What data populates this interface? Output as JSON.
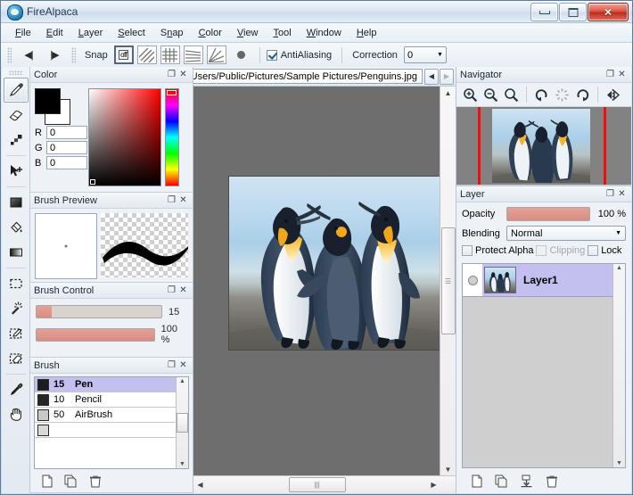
{
  "window": {
    "title": "FireAlpaca",
    "app_icon": "alpaca-icon",
    "minimize_label": "Minimize",
    "maximize_label": "Restore",
    "close_label": "Close"
  },
  "menubar": {
    "items": [
      {
        "label": "File",
        "accel": "F"
      },
      {
        "label": "Edit",
        "accel": "E"
      },
      {
        "label": "Layer",
        "accel": "L"
      },
      {
        "label": "Select",
        "accel": "S"
      },
      {
        "label": "Snap",
        "accel": "n"
      },
      {
        "label": "Color",
        "accel": "C"
      },
      {
        "label": "View",
        "accel": "V"
      },
      {
        "label": "Tool",
        "accel": "T"
      },
      {
        "label": "Window",
        "accel": "W"
      },
      {
        "label": "Help",
        "accel": "H"
      }
    ]
  },
  "toolbar": {
    "prev_label": "◀|",
    "next_label": "|▶",
    "snap_label": "Snap",
    "snap_options": [
      {
        "name": "snap-off",
        "label": "off",
        "selected": true
      },
      {
        "name": "snap-parallel",
        "label": "",
        "selected": false
      },
      {
        "name": "snap-grid",
        "label": "",
        "selected": false
      },
      {
        "name": "snap-perspective",
        "label": "",
        "selected": false
      },
      {
        "name": "snap-radial",
        "label": "",
        "selected": false
      },
      {
        "name": "snap-point",
        "label": "",
        "selected": false
      }
    ],
    "antialiasing_label": "AntiAliasing",
    "antialiasing_checked": true,
    "correction_label": "Correction",
    "correction_value": "0"
  },
  "tools": {
    "items": [
      {
        "name": "pencil-tool",
        "label": "Pencil",
        "selected": true
      },
      {
        "name": "eraser-tool",
        "label": "Eraser",
        "selected": false
      },
      {
        "name": "blur-tool",
        "label": "Blur",
        "selected": false
      },
      {
        "name": "move-tool",
        "label": "Move",
        "selected": false
      },
      {
        "name": "fill-tool",
        "label": "Fill",
        "selected": false
      },
      {
        "name": "bucket-tool",
        "label": "Bucket",
        "selected": false
      },
      {
        "name": "gradient-tool",
        "label": "Gradient",
        "selected": false
      },
      {
        "name": "select-tool",
        "label": "Select",
        "selected": false
      },
      {
        "name": "magic-wand-tool",
        "label": "Magic Wand",
        "selected": false
      },
      {
        "name": "select-pen-tool",
        "label": "Select Pen",
        "selected": false
      },
      {
        "name": "select-eraser-tool",
        "label": "Select Eraser",
        "selected": false
      },
      {
        "name": "eyedropper-tool",
        "label": "Eyedropper",
        "selected": false
      },
      {
        "name": "hand-tool",
        "label": "Hand",
        "selected": false
      }
    ]
  },
  "color_panel": {
    "title": "Color",
    "foreground": "#000000",
    "background": "#ffffff",
    "r_label": "R",
    "g_label": "G",
    "b_label": "B",
    "r_value": "0",
    "g_value": "0",
    "b_value": "0"
  },
  "brush_preview": {
    "title": "Brush Preview"
  },
  "brush_control": {
    "title": "Brush Control",
    "size_value": "15",
    "size_percent": 12,
    "opacity_value": "100 %",
    "opacity_percent": 100
  },
  "brush_panel": {
    "title": "Brush",
    "items": [
      {
        "size": "15",
        "label": "Pen",
        "swatch": "#1c1c1c",
        "selected": true
      },
      {
        "size": "10",
        "label": "Pencil",
        "swatch": "#262626",
        "selected": false
      },
      {
        "size": "50",
        "label": "AirBrush",
        "swatch": "#c9c9c9",
        "selected": false
      }
    ],
    "footer": [
      {
        "name": "new-brush-button",
        "label": "New"
      },
      {
        "name": "duplicate-brush-button",
        "label": "Duplicate"
      },
      {
        "name": "delete-brush-button",
        "label": "Delete"
      }
    ]
  },
  "document": {
    "tab_title": "s.jpg - C:/Users/Public/Pictures/Sample Pictures/Penguins.jpg",
    "prev_tab": "◀",
    "next_tab": "▶",
    "canvas_background": "#6e6e6e"
  },
  "navigator": {
    "title": "Navigator",
    "buttons": [
      {
        "name": "zoom-in-icon",
        "label": "Zoom In"
      },
      {
        "name": "zoom-out-icon",
        "label": "Zoom Out"
      },
      {
        "name": "zoom-reset-icon",
        "label": "Zoom Reset"
      },
      {
        "name": "rotate-left-icon",
        "label": "Rotate Left"
      },
      {
        "name": "rotate-reset-icon",
        "label": "Rotate Reset"
      },
      {
        "name": "rotate-right-icon",
        "label": "Rotate Right"
      },
      {
        "name": "flip-horizontal-icon",
        "label": "Flip Horizontal"
      }
    ],
    "guide_color": "#f40c0c"
  },
  "layer_panel": {
    "title": "Layer",
    "opacity_label": "Opacity",
    "opacity_value": "100 %",
    "blending_label": "Blending",
    "blending_value": "Normal",
    "protect_alpha_label": "Protect Alpha",
    "protect_alpha_checked": false,
    "clipping_label": "Clipping",
    "clipping_checked": false,
    "clipping_disabled": true,
    "lock_label": "Lock",
    "lock_checked": false,
    "layers": [
      {
        "name": "Layer1",
        "visible": true,
        "selected": true
      }
    ],
    "footer": [
      {
        "name": "add-layer-button",
        "label": "Add Layer"
      },
      {
        "name": "duplicate-layer-button",
        "label": "Duplicate Layer"
      },
      {
        "name": "merge-layer-button",
        "label": "Merge Down"
      },
      {
        "name": "delete-layer-button",
        "label": "Delete Layer"
      }
    ]
  },
  "panel_controls": {
    "float_icon": "❐",
    "close_icon": "✕"
  }
}
